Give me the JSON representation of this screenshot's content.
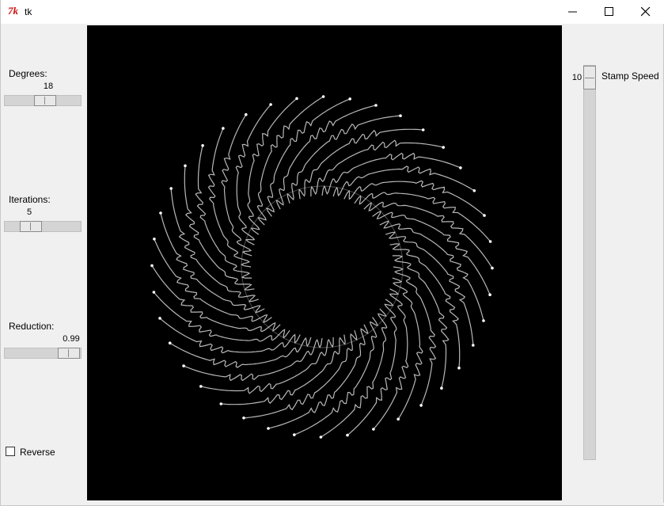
{
  "window": {
    "title": "tk",
    "icon": "tk-feather-icon",
    "controls": [
      "minimize-icon",
      "maximize-icon",
      "close-icon"
    ]
  },
  "controls": {
    "degrees": {
      "label": "Degrees:",
      "value": "18",
      "fraction": 0.55
    },
    "iterations": {
      "label": "Iterations:",
      "value": "5",
      "fraction": 0.28
    },
    "reduction": {
      "label": "Reduction:",
      "value": "0.99",
      "fraction": 0.99
    },
    "reverse": {
      "label": "Reverse",
      "checked": false
    },
    "stamp_speed": {
      "label": "Stamp Speed",
      "value": "10",
      "fraction": 0.0
    }
  },
  "canvas": {
    "background": "#000000",
    "stroke": "#d8d8d8",
    "pattern": "rotational spiral of curly white strokes"
  }
}
